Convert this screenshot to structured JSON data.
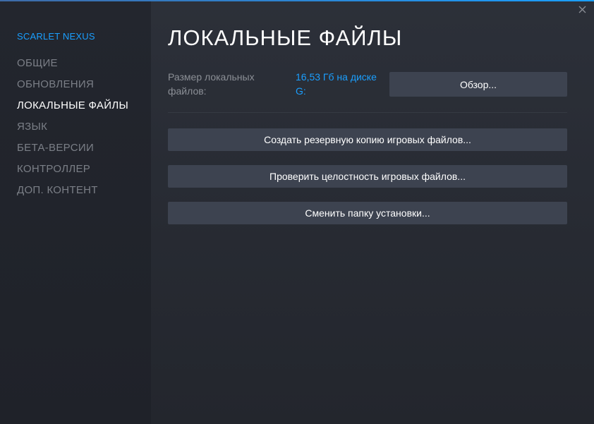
{
  "sidebar": {
    "game_title": "SCARLET NEXUS",
    "items": [
      {
        "label": "ОБЩИЕ"
      },
      {
        "label": "ОБНОВЛЕНИЯ"
      },
      {
        "label": "ЛОКАЛЬНЫЕ ФАЙЛЫ",
        "active": true
      },
      {
        "label": "ЯЗЫК"
      },
      {
        "label": "БЕТА-ВЕРСИИ"
      },
      {
        "label": "КОНТРОЛЛЕР"
      },
      {
        "label": "ДОП. КОНТЕНТ"
      }
    ]
  },
  "main": {
    "title": "ЛОКАЛЬНЫЕ ФАЙЛЫ",
    "size_label": "Размер локальных файлов:",
    "size_value": "16,53 Гб на диске G:",
    "browse_label": "Обзор...",
    "actions": [
      {
        "label": "Создать резервную копию игровых файлов..."
      },
      {
        "label": "Проверить целостность игровых файлов..."
      },
      {
        "label": "Сменить папку установки..."
      }
    ]
  },
  "window": {
    "close_icon": "close-icon"
  },
  "colors": {
    "accent": "#1a9fff",
    "text_primary": "#ffffff",
    "text_muted": "#7b7f87",
    "button_bg": "#3d4350",
    "background": "#23262e"
  }
}
